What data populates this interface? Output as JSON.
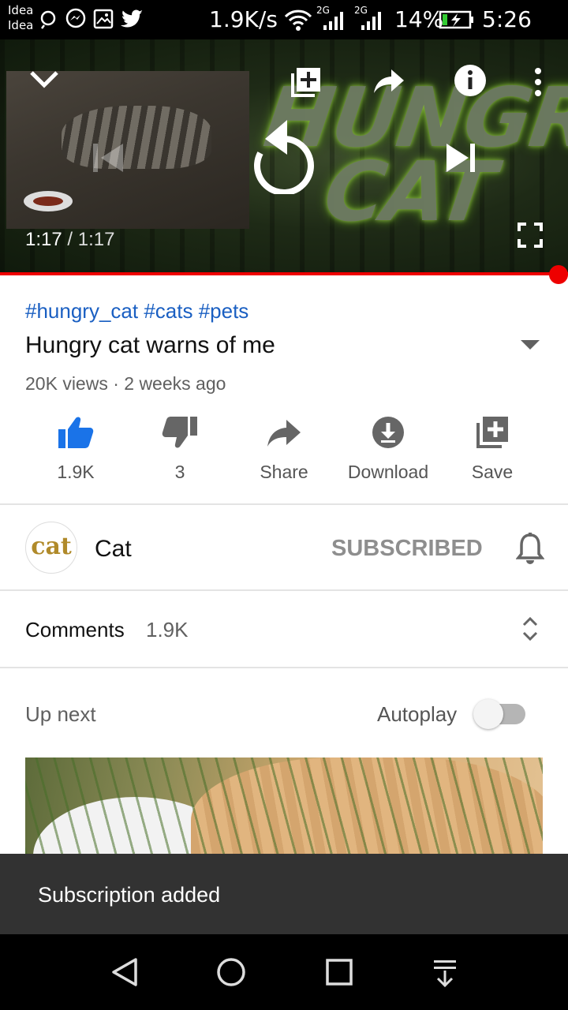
{
  "status_bar": {
    "carrier_line1": "Idea",
    "carrier_line2": "Idea",
    "speed": "1.9K/s",
    "net1": "2G",
    "net2": "2G",
    "battery": "14%",
    "time": "5:26 pm",
    "icons": [
      "search-notification-icon",
      "messenger-icon",
      "gallery-icon",
      "twitter-icon",
      "wifi-icon",
      "signal-icon",
      "battery-charging-icon"
    ]
  },
  "player": {
    "overlay_title_line1": "HUNGRY",
    "overlay_title_line2": "CAT",
    "current_time": "1:17",
    "separator": " / ",
    "duration": "1:17",
    "progress_fraction": 1.0,
    "icons": [
      "collapse-chevron-icon",
      "add-to-playlist-icon",
      "share-icon",
      "info-icon",
      "more-vert-icon",
      "previous-icon",
      "replay-icon",
      "next-icon",
      "fullscreen-icon"
    ]
  },
  "video": {
    "tags": "#hungry_cat #cats #pets",
    "title": "Hungry cat warns of me",
    "meta": "20K views · 2 weeks ago"
  },
  "actions": [
    {
      "name": "like",
      "label": "1.9K",
      "icon": "thumbs-up-icon"
    },
    {
      "name": "dislike",
      "label": "3",
      "icon": "thumbs-down-icon"
    },
    {
      "name": "share",
      "label": "Share",
      "icon": "share-icon"
    },
    {
      "name": "download",
      "label": "Download",
      "icon": "download-icon"
    },
    {
      "name": "save",
      "label": "Save",
      "icon": "save-playlist-icon"
    }
  ],
  "channel": {
    "avatar_text": "cat",
    "name": "Cat",
    "subscribe_label": "SUBSCRIBED"
  },
  "comments": {
    "label": "Comments",
    "count": "1.9K"
  },
  "up_next": {
    "label": "Up next",
    "autoplay_label": "Autoplay",
    "autoplay_on": false
  },
  "snackbar": {
    "message": "Subscription added"
  },
  "navbar": {
    "icons": [
      "back-icon",
      "home-icon",
      "recents-icon",
      "notification-pull-icon"
    ]
  },
  "colors": {
    "accent_red": "#ee0000",
    "link_blue": "#1a5fc2",
    "like_blue": "#1a73e8",
    "snackbar_bg": "#323232"
  }
}
